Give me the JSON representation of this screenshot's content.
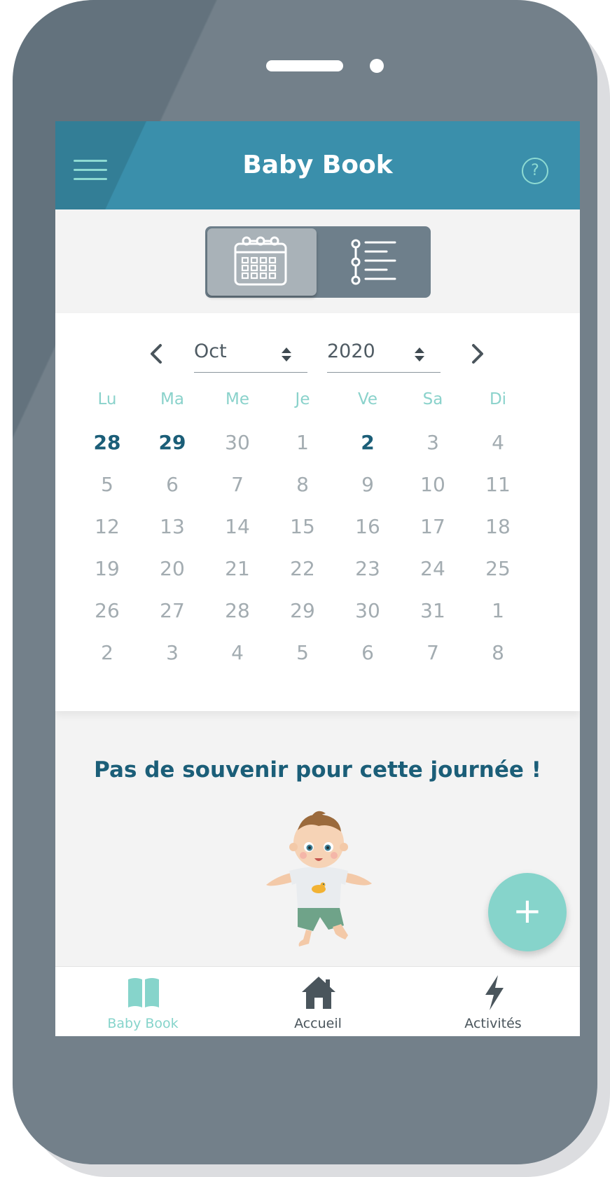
{
  "colors": {
    "header": "#3a8fab",
    "accent": "#86d4cb",
    "primary_text": "#1b5e78",
    "muted_day": "#a3acb1",
    "frame": "#63727d"
  },
  "header": {
    "title": "Baby Book",
    "menu_icon": "hamburger-menu-icon",
    "help_icon": "help-circle-icon",
    "help_glyph": "?"
  },
  "view_toggle": {
    "selected": "calendar",
    "options": [
      {
        "id": "calendar",
        "icon": "calendar-icon"
      },
      {
        "id": "list",
        "icon": "timeline-list-icon"
      }
    ]
  },
  "calendar": {
    "prev_icon": "chevron-left-icon",
    "next_icon": "chevron-right-icon",
    "month": "Oct",
    "year": "2020",
    "weekdays": [
      "Lu",
      "Ma",
      "Me",
      "Je",
      "Ve",
      "Sa",
      "Di"
    ],
    "weeks": [
      [
        {
          "d": "28",
          "m": true
        },
        {
          "d": "29",
          "m": true
        },
        {
          "d": "30"
        },
        {
          "d": "1"
        },
        {
          "d": "2",
          "m": true
        },
        {
          "d": "3"
        },
        {
          "d": "4"
        }
      ],
      [
        {
          "d": "5"
        },
        {
          "d": "6"
        },
        {
          "d": "7"
        },
        {
          "d": "8"
        },
        {
          "d": "9"
        },
        {
          "d": "10"
        },
        {
          "d": "11"
        }
      ],
      [
        {
          "d": "12"
        },
        {
          "d": "13"
        },
        {
          "d": "14"
        },
        {
          "d": "15"
        },
        {
          "d": "16"
        },
        {
          "d": "17"
        },
        {
          "d": "18"
        }
      ],
      [
        {
          "d": "19"
        },
        {
          "d": "20"
        },
        {
          "d": "21"
        },
        {
          "d": "22"
        },
        {
          "d": "23"
        },
        {
          "d": "24"
        },
        {
          "d": "25"
        }
      ],
      [
        {
          "d": "26"
        },
        {
          "d": "27"
        },
        {
          "d": "28"
        },
        {
          "d": "29"
        },
        {
          "d": "30"
        },
        {
          "d": "31"
        },
        {
          "d": "1"
        }
      ],
      [
        {
          "d": "2"
        },
        {
          "d": "3"
        },
        {
          "d": "4"
        },
        {
          "d": "5"
        },
        {
          "d": "6"
        },
        {
          "d": "7"
        },
        {
          "d": "8"
        }
      ]
    ]
  },
  "empty_state": {
    "message": "Pas de souvenir pour cette journée !",
    "illustration": "baby-illustration"
  },
  "fab": {
    "glyph": "+",
    "icon": "plus-icon"
  },
  "bottom_nav": {
    "items": [
      {
        "label": "Baby Book",
        "icon": "open-book-icon",
        "active": true
      },
      {
        "label": "Accueil",
        "icon": "home-icon",
        "active": false
      },
      {
        "label": "Activités",
        "icon": "lightning-bolt-icon",
        "active": false
      }
    ]
  }
}
